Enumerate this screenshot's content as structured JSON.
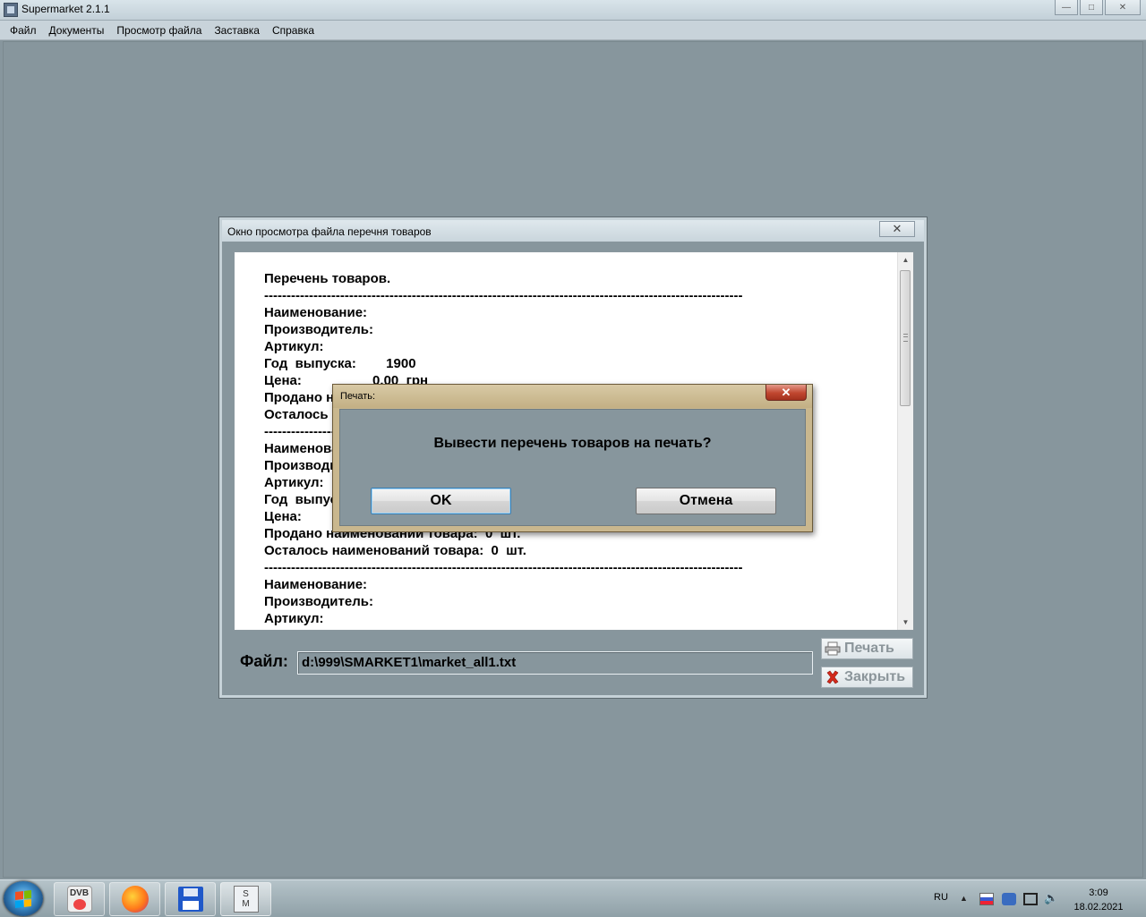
{
  "app": {
    "title": "Supermarket 2.1.1"
  },
  "window_controls": {
    "minimize": "—",
    "maximize": "□",
    "close": "✕"
  },
  "menu": [
    "Файл",
    "Документы",
    "Просмотр файла",
    "Заставка",
    "Справка"
  ],
  "viewer": {
    "title": "Окно просмотра файла перечня товаров",
    "close_glyph": "✕",
    "content": "Перечень товаров.\n-----------------------------------------------------------------------------------------------------------\nНаименование:\nПроизводитель:\nАртикул:\nГод  выпуска:        1900\nЦена:                   0.00  грн\nПродано наименований товара:  1  шт.\nОсталось наименований товара:  0  шт.\n-----------------------------------------------------------------------------------------------------------\nНаименование:\nПроизводитель:\nАртикул:\nГод  выпуска:        1900\nЦена:                   0.00  грн\nПродано наименований товара:  0  шт.\nОсталось наименований товара:  0  шт.\n-----------------------------------------------------------------------------------------------------------\nНаименование:\nПроизводитель:\nАртикул:",
    "file_label": "Файл:",
    "file_path": "d:\\999\\SMARKET1\\market_all1.txt",
    "print_label": "Печать",
    "close_label": "Закрыть"
  },
  "dialog": {
    "title": "Печать:",
    "message": "Вывести перечень товаров на печать?",
    "ok_label": "OK",
    "cancel_label": "Отмена",
    "close_glyph": "✕"
  },
  "taskbar": {
    "dvb_label": "DVB",
    "sm_label_top": "S",
    "sm_label_bottom": "M",
    "language": "RU",
    "time": "3:09",
    "date": "18.02.2021"
  }
}
